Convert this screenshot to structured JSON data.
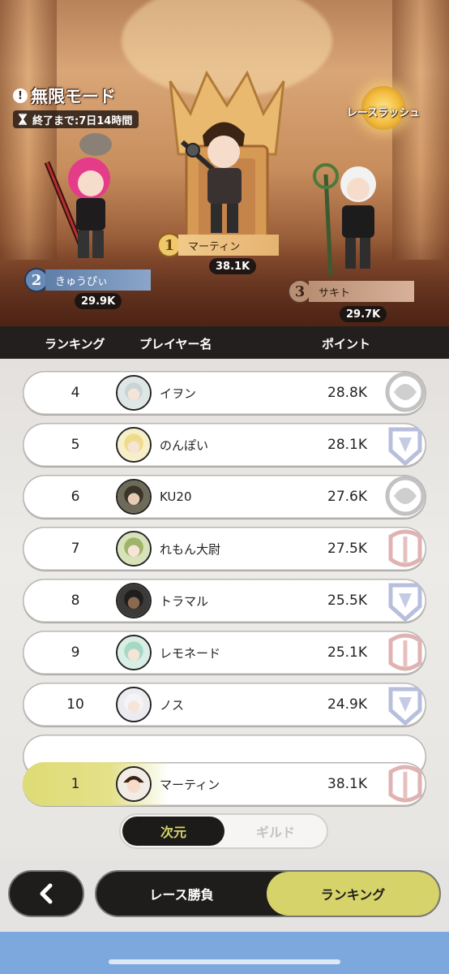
{
  "mode": {
    "icon": "exclamation-circle-icon",
    "title": "無限モード",
    "timer_icon": "hourglass-icon",
    "timer": "終了まで:7日14時間",
    "rush_label": "レースラッシュ"
  },
  "podium": [
    {
      "rank": "1",
      "name": "マーティン",
      "score": "38.1K"
    },
    {
      "rank": "2",
      "name": "きゅうぴぃ",
      "score": "29.9K"
    },
    {
      "rank": "3",
      "name": "サキト",
      "score": "29.7K"
    }
  ],
  "table_header": {
    "rank": "ランキング",
    "player": "プレイヤー名",
    "points": "ポイント"
  },
  "rows": [
    {
      "rank": "4",
      "name": "イヲン",
      "points": "28.8K",
      "emblem": "silver"
    },
    {
      "rank": "5",
      "name": "のんぽい",
      "points": "28.1K",
      "emblem": "blue"
    },
    {
      "rank": "6",
      "name": "KU20",
      "points": "27.6K",
      "emblem": "silver"
    },
    {
      "rank": "7",
      "name": "れもん大尉",
      "points": "27.5K",
      "emblem": "red"
    },
    {
      "rank": "8",
      "name": "トラマル",
      "points": "25.5K",
      "emblem": "blue"
    },
    {
      "rank": "9",
      "name": "レモネード",
      "points": "25.1K",
      "emblem": "red"
    },
    {
      "rank": "10",
      "name": "ノス",
      "points": "24.9K",
      "emblem": "blue"
    }
  ],
  "my_row": {
    "rank": "1",
    "name": "マーティン",
    "points": "38.1K"
  },
  "segment": {
    "active": "次元",
    "inactive": "ギルド"
  },
  "bottom": {
    "back_icon": "chevron-left-icon",
    "tab_race": "レース勝負",
    "tab_ranking": "ランキング"
  },
  "colors": {
    "accent": "#d6d36b",
    "dark": "#1e1d1c",
    "footer": "#7ca8de"
  }
}
